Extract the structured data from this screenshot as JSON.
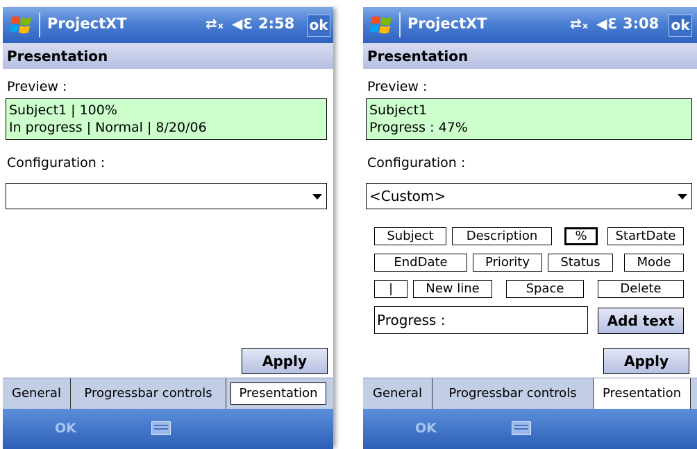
{
  "screens": [
    {
      "app_title": "ProjectXT",
      "time": "2:58",
      "ok_label": "ok",
      "header": "Presentation",
      "preview_label": "Preview :",
      "preview_line1": "Subject1 | 100%",
      "preview_line2": "In progress | Normal | 8/20/06",
      "config_label": "Configuration :",
      "config_value": "",
      "apply_label": "Apply",
      "tabs": [
        "General",
        "Progressbar controls",
        "Presentation"
      ],
      "softkey_left": "OK"
    },
    {
      "app_title": "ProjectXT",
      "time": "3:08",
      "ok_label": "ok",
      "header": "Presentation",
      "preview_label": "Preview :",
      "preview_line1": "Subject1",
      "preview_line2": "Progress : 47%",
      "config_label": "Configuration :",
      "config_value": "<Custom>",
      "tokens_row1": [
        "Subject",
        "Description",
        "%",
        "StartDate"
      ],
      "tokens_row2": [
        "EndDate",
        "Priority",
        "Status",
        "Mode"
      ],
      "tokens_row3": [
        "|",
        "New line",
        "Space",
        "Delete"
      ],
      "text_value": "Progress :",
      "add_text_label": "Add text",
      "apply_label": "Apply",
      "tabs": [
        "General",
        "Progressbar controls",
        "Presentation"
      ],
      "softkey_left": "OK"
    }
  ],
  "icons": [
    "windows-logo-icon",
    "connectivity-icon",
    "speaker-icon",
    "keyboard-icon"
  ]
}
